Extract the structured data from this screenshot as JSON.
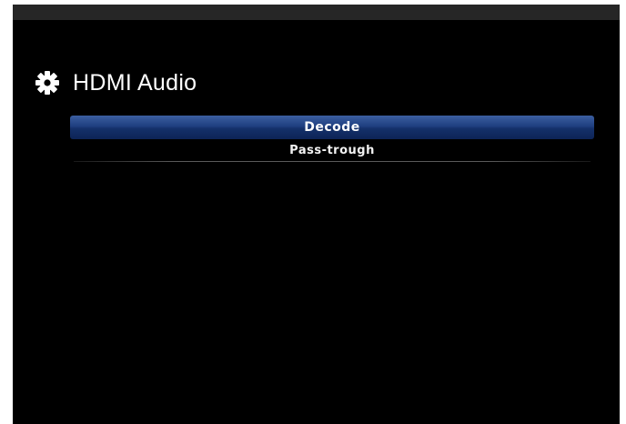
{
  "header": {
    "icon": "gear-icon",
    "title": "HDMI Audio"
  },
  "menu": {
    "items": [
      {
        "label": "Decode",
        "selected": true
      },
      {
        "label": "Pass-trough",
        "selected": false
      }
    ]
  },
  "colors": {
    "background": "#000000",
    "selection": "#1f3f80",
    "text": "#ffffff"
  }
}
